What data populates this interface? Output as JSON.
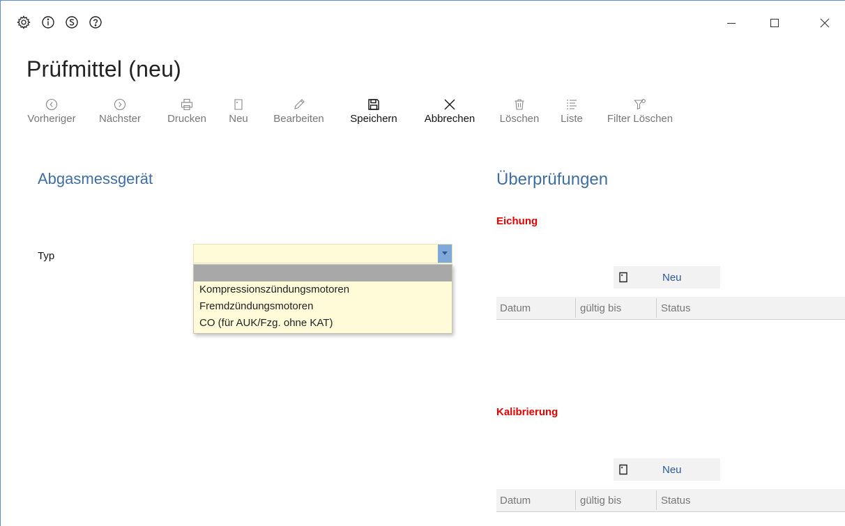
{
  "window": {
    "title_icons": [
      "gear-icon",
      "info-icon",
      "s-circle-icon",
      "help-icon"
    ],
    "controls": [
      "minimize-icon",
      "maximize-icon",
      "close-icon"
    ]
  },
  "page": {
    "title": "Prüfmittel (neu)"
  },
  "toolbar": {
    "previous": "Vorheriger",
    "next": "Nächster",
    "print": "Drucken",
    "new": "Neu",
    "edit": "Bearbeiten",
    "save": "Speichern",
    "cancel": "Abbrechen",
    "delete": "Löschen",
    "list": "Liste",
    "clear_filter": "Filter Löschen"
  },
  "left": {
    "section_title": "Abgasmessgerät",
    "typ_label": "Typ",
    "typ_value": "",
    "typ_options": [
      "",
      "Kompressionszündungsmotoren",
      "Fremdzündungsmotoren",
      "CO (für AUK/Fzg. ohne KAT)"
    ]
  },
  "right": {
    "section_title": "Überprüfungen",
    "eichung": {
      "title": "Eichung",
      "new_label": "Neu",
      "columns": [
        "Datum",
        "gültig bis",
        "Status"
      ]
    },
    "kalibrierung": {
      "title": "Kalibrierung",
      "new_label": "Neu",
      "columns": [
        "Datum",
        "gültig bis",
        "Status"
      ]
    }
  },
  "colors": {
    "accent_blue": "#3e6ea3",
    "required_red": "#e60000",
    "field_bg": "#fffbd8",
    "combo_arrow": "#7ea9d8"
  }
}
